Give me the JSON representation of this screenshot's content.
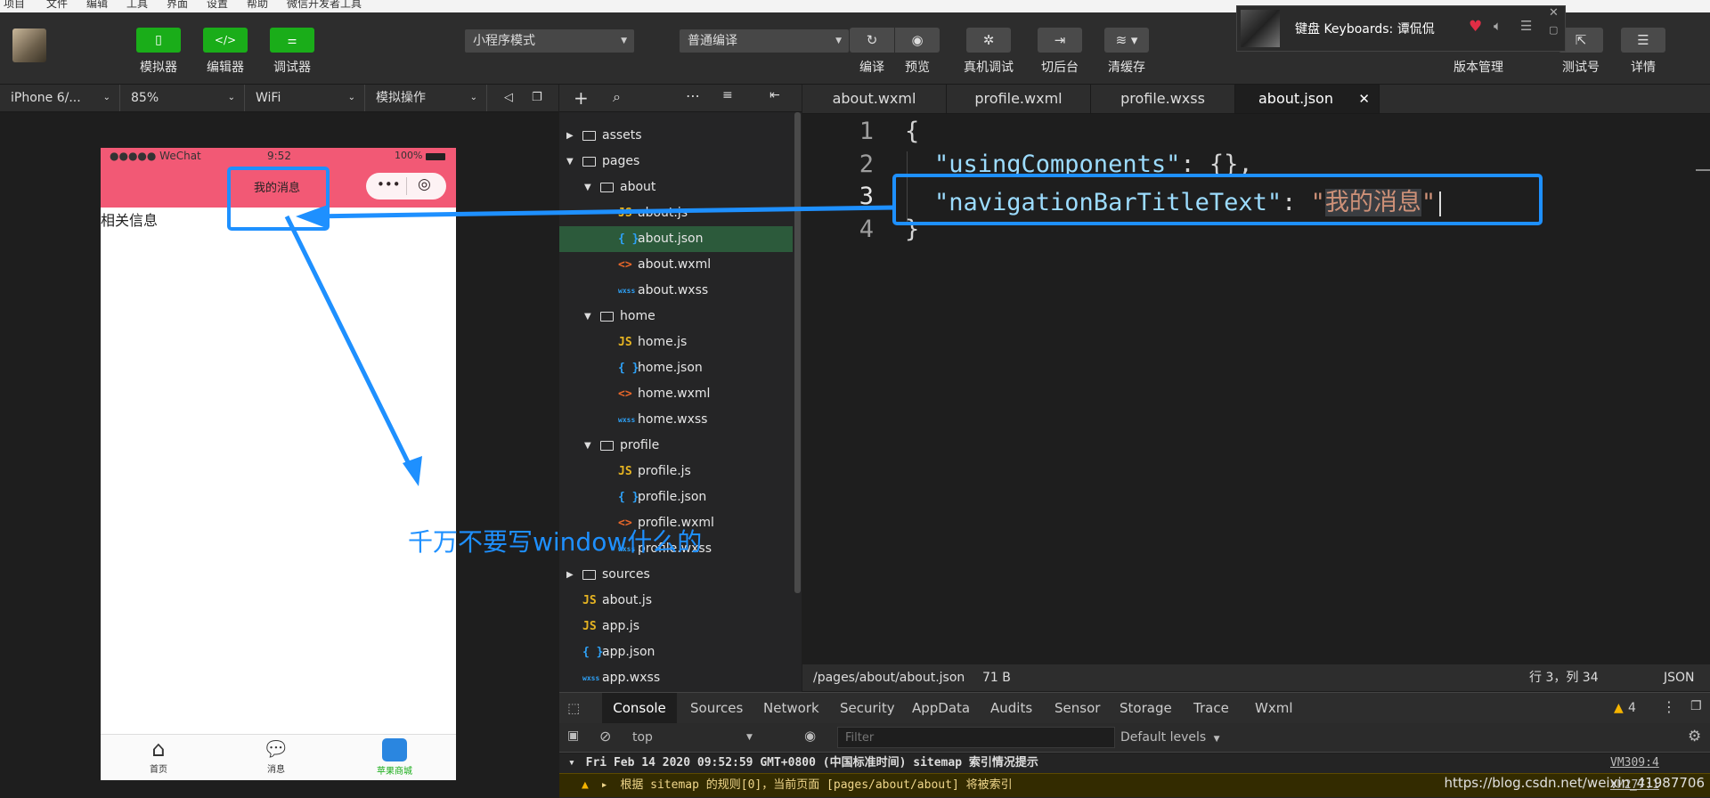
{
  "menubar": [
    "项目",
    "文件",
    "编辑",
    "工具",
    "界面",
    "设置",
    "帮助",
    "微信开发者工具"
  ],
  "toolbar": {
    "simulator": "模拟器",
    "editor": "编辑器",
    "debugger": "调试器",
    "mode": "小程序模式",
    "compile_mode": "普通编译",
    "compile": "编译",
    "preview": "预览",
    "remote_debug": "真机调试",
    "backend": "切后台",
    "clear_cache": "清缓存",
    "version_mgmt": "版本管理",
    "test_account": "测试号",
    "details": "详情"
  },
  "music": {
    "title": "键盘 Keyboards: 谭侃侃"
  },
  "simbar": {
    "device": "iPhone 6/...",
    "zoom": "85%",
    "network": "WiFi",
    "operation": "模拟操作"
  },
  "phone": {
    "carrier": "●●●●● WeChat",
    "time": "9:52",
    "battery": "100%",
    "nav_title": "我的消息",
    "body_text": "相关信息",
    "tabs": [
      "首页",
      "消息",
      "苹果商城"
    ]
  },
  "tree": [
    {
      "label": "assets",
      "type": "folder",
      "depth": 0,
      "open": false
    },
    {
      "label": "pages",
      "type": "folder",
      "depth": 0,
      "open": true
    },
    {
      "label": "about",
      "type": "folder",
      "depth": 1,
      "open": true
    },
    {
      "label": "about.js",
      "type": "js",
      "depth": 2
    },
    {
      "label": "about.json",
      "type": "json",
      "depth": 2,
      "selected": true
    },
    {
      "label": "about.wxml",
      "type": "wxml",
      "depth": 2
    },
    {
      "label": "about.wxss",
      "type": "wxss",
      "depth": 2
    },
    {
      "label": "home",
      "type": "folder",
      "depth": 1,
      "open": true
    },
    {
      "label": "home.js",
      "type": "js",
      "depth": 2
    },
    {
      "label": "home.json",
      "type": "json",
      "depth": 2
    },
    {
      "label": "home.wxml",
      "type": "wxml",
      "depth": 2
    },
    {
      "label": "home.wxss",
      "type": "wxss",
      "depth": 2
    },
    {
      "label": "profile",
      "type": "folder",
      "depth": 1,
      "open": true
    },
    {
      "label": "profile.js",
      "type": "js",
      "depth": 2
    },
    {
      "label": "profile.json",
      "type": "json",
      "depth": 2
    },
    {
      "label": "profile.wxml",
      "type": "wxml",
      "depth": 2
    },
    {
      "label": "profile.wxss",
      "type": "wxss",
      "depth": 2
    },
    {
      "label": "sources",
      "type": "folder",
      "depth": 0,
      "open": false
    },
    {
      "label": "about.js",
      "type": "js",
      "depth": 0
    },
    {
      "label": "app.js",
      "type": "js",
      "depth": 0
    },
    {
      "label": "app.json",
      "type": "json",
      "depth": 0
    },
    {
      "label": "app.wxss",
      "type": "wxss",
      "depth": 0
    }
  ],
  "icon_glyphs": {
    "js": "JS",
    "json": "{ }",
    "wxml": "<>",
    "wxss": "wxss"
  },
  "editor_tabs": [
    "about.wxml",
    "profile.wxml",
    "profile.wxss",
    "about.json"
  ],
  "editor": {
    "line_numbers": [
      "1",
      "2",
      "3",
      "4"
    ],
    "code": {
      "l1_brace": "{",
      "l2_key": "\"usingComponents\"",
      "l2_rest": ": {},",
      "l3_key": "\"navigationBarTitleText\"",
      "l3_colon": ": ",
      "l3_quote_open": "\"",
      "l3_value": "我的消息",
      "l3_quote_close": "\"",
      "l4_brace": "}"
    }
  },
  "status": {
    "path": "/pages/about/about.json",
    "size": "71 B",
    "cursor": "行 3，列 34",
    "lang": "JSON"
  },
  "console_tabs": [
    "Console",
    "Sources",
    "Network",
    "Security",
    "AppData",
    "Audits",
    "Sensor",
    "Storage",
    "Trace",
    "Wxml"
  ],
  "console": {
    "warn_count": "4",
    "context": "top",
    "filter_placeholder": "Filter",
    "levels": "Default levels",
    "log1": "Fri Feb 14 2020 09:52:59 GMT+0800 (中国标准时间) sitemap 索引情况提示",
    "log1_src": "VM309:4",
    "log2": "根据 sitemap 的规则[0]，当前页面 [pages/about/about] 将被索引",
    "log2_src": "VM277:1"
  },
  "annotation": {
    "text": "千万不要写window什么的"
  },
  "watermark": "https://blog.csdn.net/weixin_41987706",
  "colors": {
    "accent_green": "#1aad19",
    "nav_pink": "#f25975",
    "annotation_blue": "#1e90ff"
  }
}
